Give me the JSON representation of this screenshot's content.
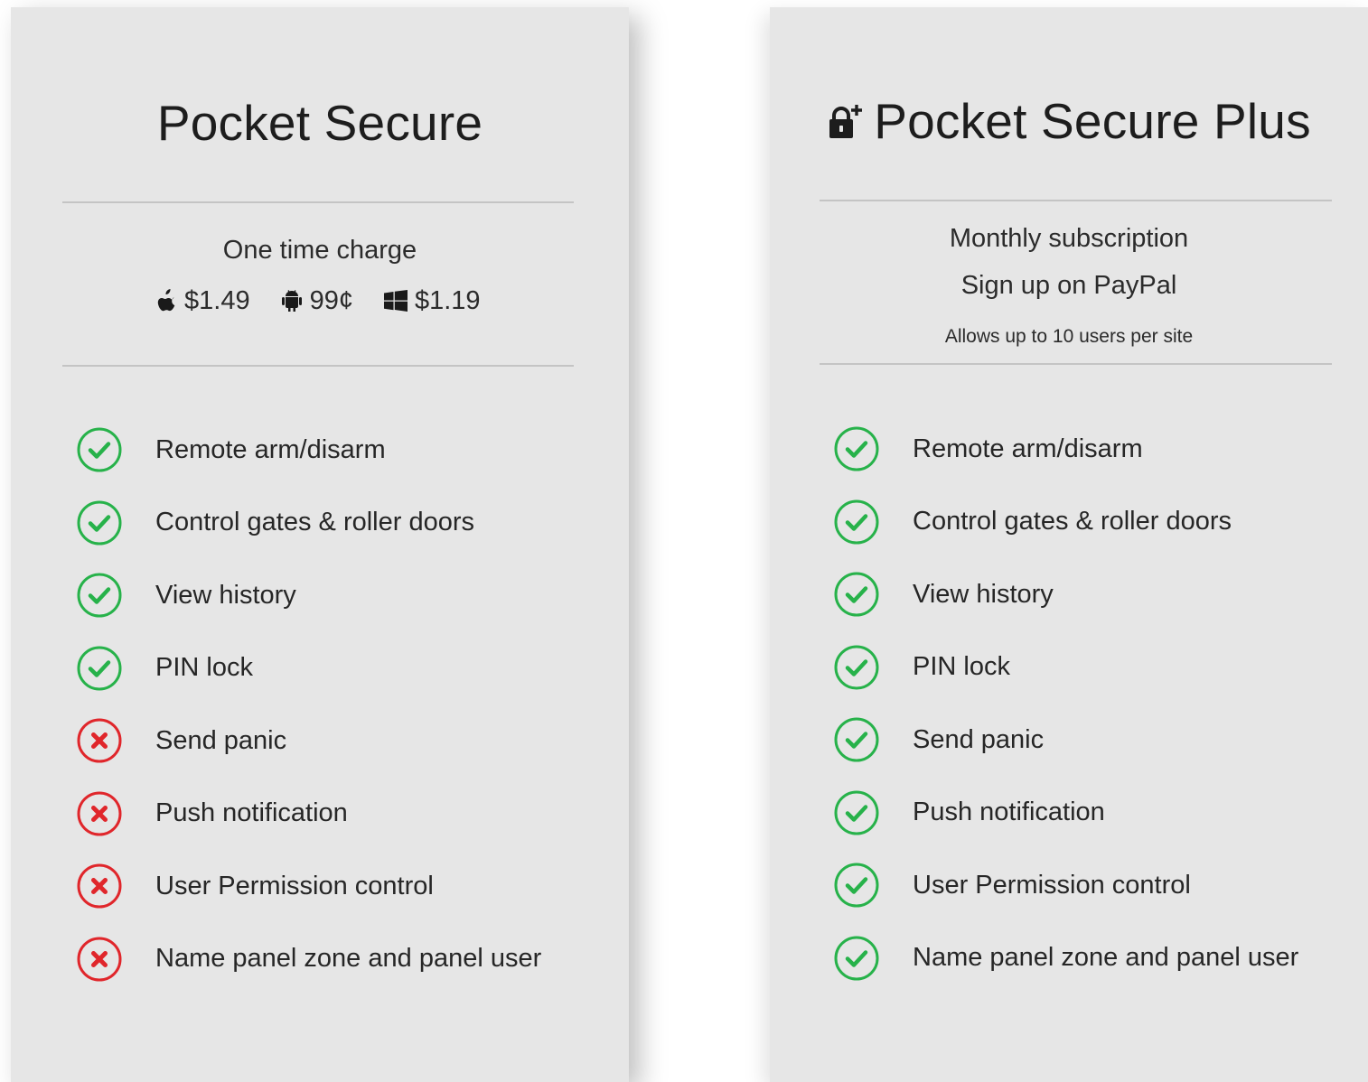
{
  "colors": {
    "card_bg": "#e6e6e6",
    "check_green": "#27b24a",
    "cross_red": "#e0262b",
    "text": "#1f1f1f",
    "divider": "#c4c4c4"
  },
  "plans": [
    {
      "title": "Pocket Secure",
      "pricing": {
        "label": "One time charge",
        "prices": [
          {
            "platform_icon": "apple-icon",
            "price": "$1.49"
          },
          {
            "platform_icon": "android-icon",
            "price": "99¢"
          },
          {
            "platform_icon": "windows-icon",
            "price": "$1.19"
          }
        ]
      },
      "features": [
        {
          "label": "Remote arm/disarm",
          "included": true
        },
        {
          "label": "Control gates & roller doors",
          "included": true
        },
        {
          "label": "View history",
          "included": true
        },
        {
          "label": "PIN lock",
          "included": true
        },
        {
          "label": "Send panic",
          "included": false
        },
        {
          "label": "Push notification",
          "included": false
        },
        {
          "label": "User Permission control",
          "included": false
        },
        {
          "label": "Name panel zone and panel user",
          "included": false
        }
      ]
    },
    {
      "title": "Pocket Secure Plus",
      "title_icon": "lock-plus-icon",
      "pricing": {
        "line1": "Monthly subscription",
        "line2": "Sign up on PayPal",
        "line3": "Allows up to 10 users per site"
      },
      "features": [
        {
          "label": "Remote arm/disarm",
          "included": true
        },
        {
          "label": "Control gates & roller doors",
          "included": true
        },
        {
          "label": "View history",
          "included": true
        },
        {
          "label": "PIN lock",
          "included": true
        },
        {
          "label": "Send panic",
          "included": true
        },
        {
          "label": "Push notification",
          "included": true
        },
        {
          "label": "User Permission control",
          "included": true
        },
        {
          "label": "Name panel zone and panel user",
          "included": true
        }
      ]
    }
  ]
}
